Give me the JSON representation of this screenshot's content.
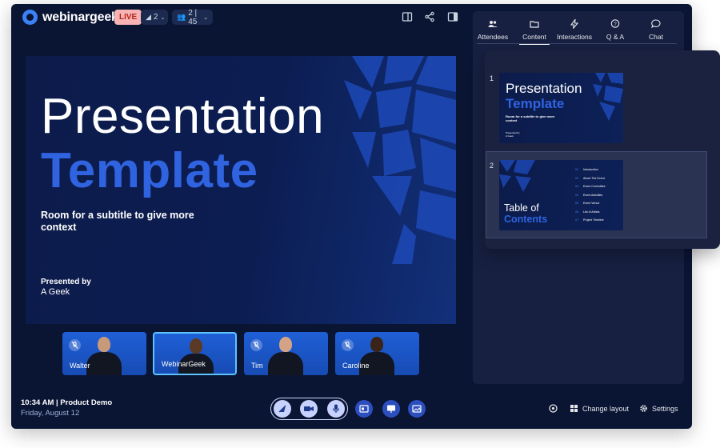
{
  "brand": {
    "name": "webinargeek",
    "accent": "#3b82f6"
  },
  "header": {
    "live_label": "LIVE",
    "presenters_count": "2",
    "attendees_count": "2 | 45",
    "icons": [
      "layout-panel-icon",
      "share-icon",
      "sidebar-toggle-icon"
    ]
  },
  "slide": {
    "title_line1": "Presentation",
    "title_line2": "Template",
    "subtitle": "Room for a subtitle to give more context",
    "presented_by_label": "Presented by",
    "presenter_name": "A Geek"
  },
  "participants": [
    {
      "name": "Walter",
      "muted": true,
      "active": false
    },
    {
      "name": "WebinarGeek",
      "muted": false,
      "active": true
    },
    {
      "name": "Tim",
      "muted": true,
      "active": false
    },
    {
      "name": "Caroline",
      "muted": true,
      "active": false
    }
  ],
  "footer": {
    "time_title": "10:34 AM | Product Demo",
    "date": "Friday, August 12",
    "change_layout_label": "Change layout",
    "settings_label": "Settings"
  },
  "panel": {
    "tabs": [
      {
        "label": "Attendees",
        "icon": "users-icon"
      },
      {
        "label": "Content",
        "icon": "folder-icon",
        "selected": true
      },
      {
        "label": "Interactions",
        "icon": "bolt-icon"
      },
      {
        "label": "Q & A",
        "icon": "question-bubble-icon"
      },
      {
        "label": "Chat",
        "icon": "chat-bubble-icon"
      }
    ]
  },
  "content_slides": {
    "items": [
      {
        "number": "1",
        "title_line1": "Presentation",
        "title_line2": "Template",
        "subtitle": "Room for a subtitle to give more context",
        "presented_by": "Presented by",
        "presenter": "A Geek"
      },
      {
        "number": "2",
        "title_line1": "Table of",
        "title_line2": "Contents",
        "toc": [
          {
            "num": "01",
            "label": "Introduction"
          },
          {
            "num": "02",
            "label": "About The Event"
          },
          {
            "num": "03",
            "label": "Event Committee"
          },
          {
            "num": "04",
            "label": "Event Activities"
          },
          {
            "num": "05",
            "label": "Event Venue"
          },
          {
            "num": "06",
            "label": "List of Artists"
          },
          {
            "num": "07",
            "label": "Project Timeline"
          }
        ]
      }
    ]
  }
}
